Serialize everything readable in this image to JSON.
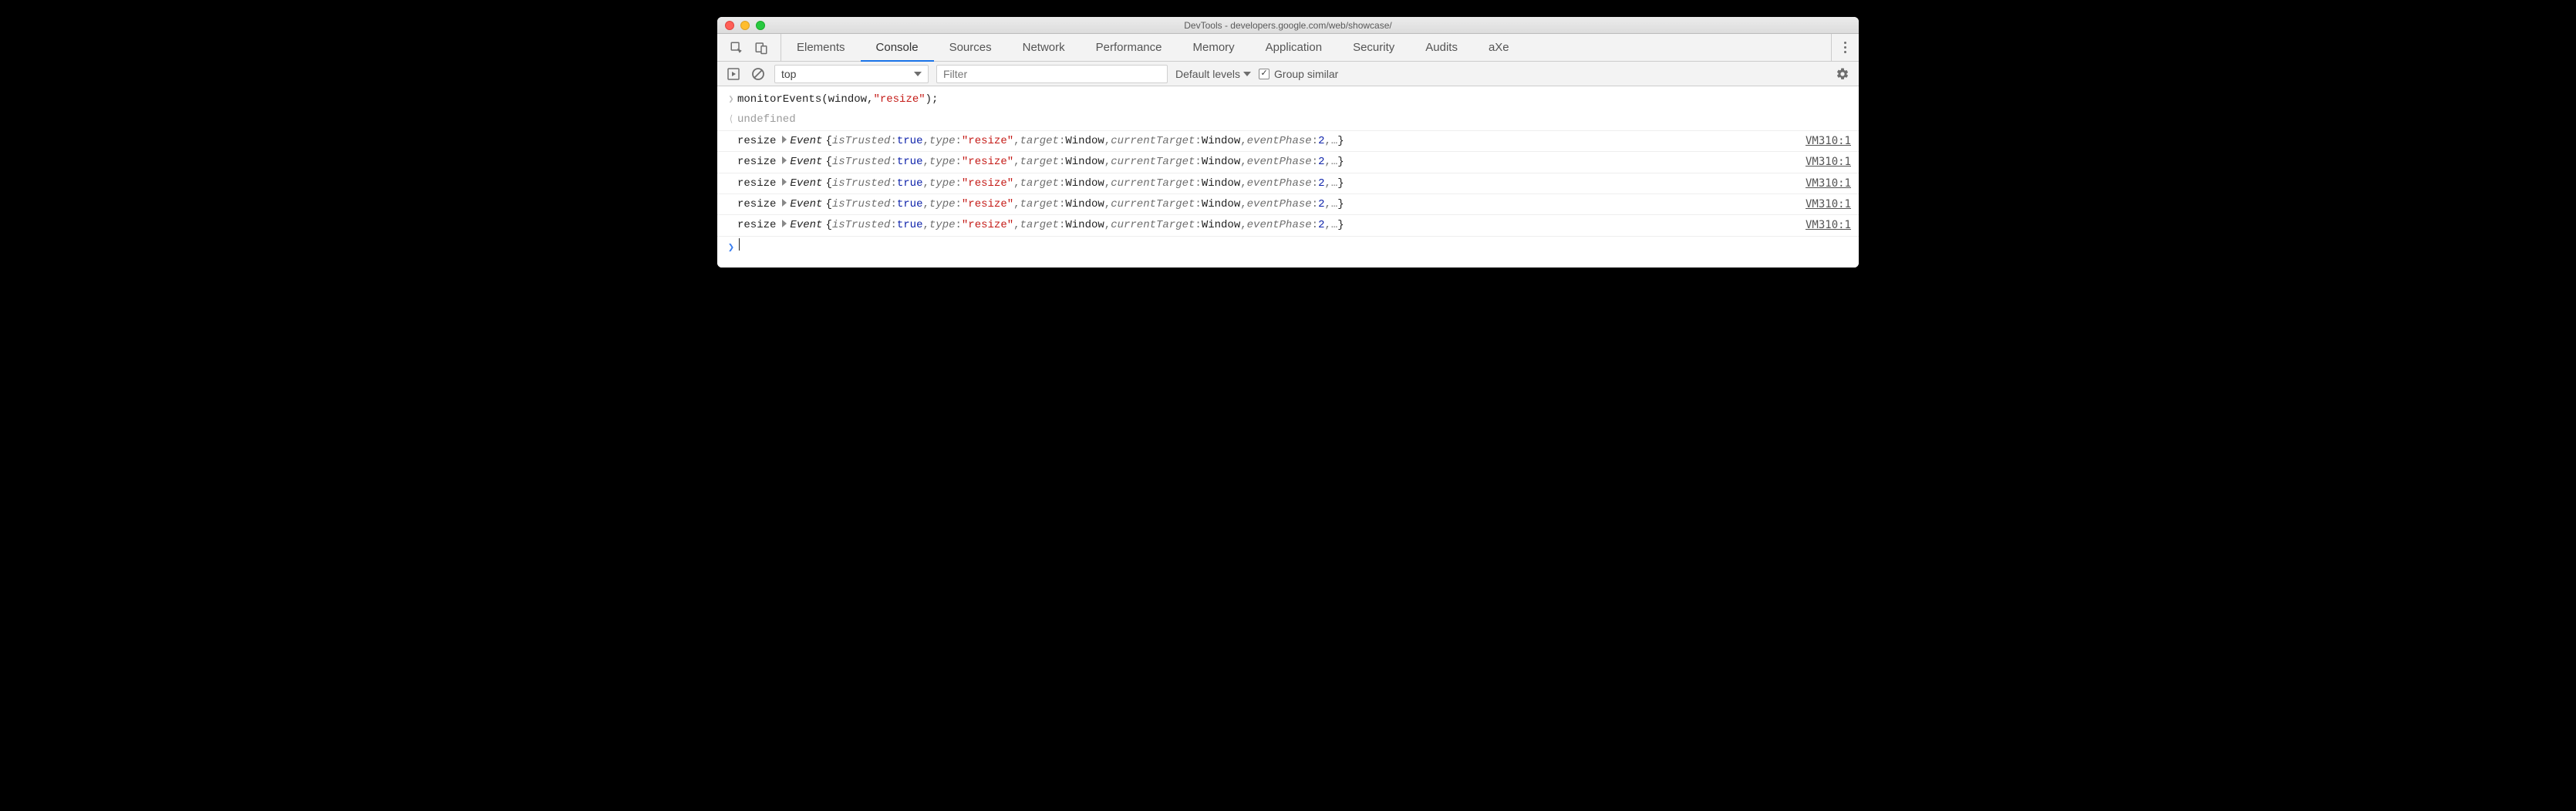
{
  "window": {
    "title": "DevTools - developers.google.com/web/showcase/"
  },
  "icons": {
    "inspect": "inspect-element",
    "device": "device-toolbar",
    "play": "play",
    "clear": "clear",
    "gear": "settings"
  },
  "tabs": [
    {
      "label": "Elements",
      "id": "elements",
      "active": false
    },
    {
      "label": "Console",
      "id": "console",
      "active": true
    },
    {
      "label": "Sources",
      "id": "sources",
      "active": false
    },
    {
      "label": "Network",
      "id": "network",
      "active": false
    },
    {
      "label": "Performance",
      "id": "performance",
      "active": false
    },
    {
      "label": "Memory",
      "id": "memory",
      "active": false
    },
    {
      "label": "Application",
      "id": "application",
      "active": false
    },
    {
      "label": "Security",
      "id": "security",
      "active": false
    },
    {
      "label": "Audits",
      "id": "audits",
      "active": false
    },
    {
      "label": "aXe",
      "id": "axe",
      "active": false
    }
  ],
  "toolbar": {
    "context": "top",
    "filter_placeholder": "Filter",
    "levels_label": "Default levels",
    "group_similar_label": "Group similar",
    "group_similar_checked": true
  },
  "console": {
    "input": {
      "func": "monitorEvents",
      "open": "(window, ",
      "arg_str": "\"resize\"",
      "close": ");"
    },
    "result": "undefined",
    "events": [
      {
        "label": "resize",
        "type": "Event",
        "props": [
          {
            "key": "isTrusted",
            "val": "true",
            "kind": "bool"
          },
          {
            "key": "type",
            "val": "\"resize\"",
            "kind": "str"
          },
          {
            "key": "target",
            "val": "Window",
            "kind": "ref"
          },
          {
            "key": "currentTarget",
            "val": "Window",
            "kind": "ref"
          },
          {
            "key": "eventPhase",
            "val": "2",
            "kind": "num"
          }
        ],
        "source": "VM310:1"
      },
      {
        "label": "resize",
        "type": "Event",
        "props": [
          {
            "key": "isTrusted",
            "val": "true",
            "kind": "bool"
          },
          {
            "key": "type",
            "val": "\"resize\"",
            "kind": "str"
          },
          {
            "key": "target",
            "val": "Window",
            "kind": "ref"
          },
          {
            "key": "currentTarget",
            "val": "Window",
            "kind": "ref"
          },
          {
            "key": "eventPhase",
            "val": "2",
            "kind": "num"
          }
        ],
        "source": "VM310:1"
      },
      {
        "label": "resize",
        "type": "Event",
        "props": [
          {
            "key": "isTrusted",
            "val": "true",
            "kind": "bool"
          },
          {
            "key": "type",
            "val": "\"resize\"",
            "kind": "str"
          },
          {
            "key": "target",
            "val": "Window",
            "kind": "ref"
          },
          {
            "key": "currentTarget",
            "val": "Window",
            "kind": "ref"
          },
          {
            "key": "eventPhase",
            "val": "2",
            "kind": "num"
          }
        ],
        "source": "VM310:1"
      },
      {
        "label": "resize",
        "type": "Event",
        "props": [
          {
            "key": "isTrusted",
            "val": "true",
            "kind": "bool"
          },
          {
            "key": "type",
            "val": "\"resize\"",
            "kind": "str"
          },
          {
            "key": "target",
            "val": "Window",
            "kind": "ref"
          },
          {
            "key": "currentTarget",
            "val": "Window",
            "kind": "ref"
          },
          {
            "key": "eventPhase",
            "val": "2",
            "kind": "num"
          }
        ],
        "source": "VM310:1"
      },
      {
        "label": "resize",
        "type": "Event",
        "props": [
          {
            "key": "isTrusted",
            "val": "true",
            "kind": "bool"
          },
          {
            "key": "type",
            "val": "\"resize\"",
            "kind": "str"
          },
          {
            "key": "target",
            "val": "Window",
            "kind": "ref"
          },
          {
            "key": "currentTarget",
            "val": "Window",
            "kind": "ref"
          },
          {
            "key": "eventPhase",
            "val": "2",
            "kind": "num"
          }
        ],
        "source": "VM310:1"
      }
    ]
  }
}
